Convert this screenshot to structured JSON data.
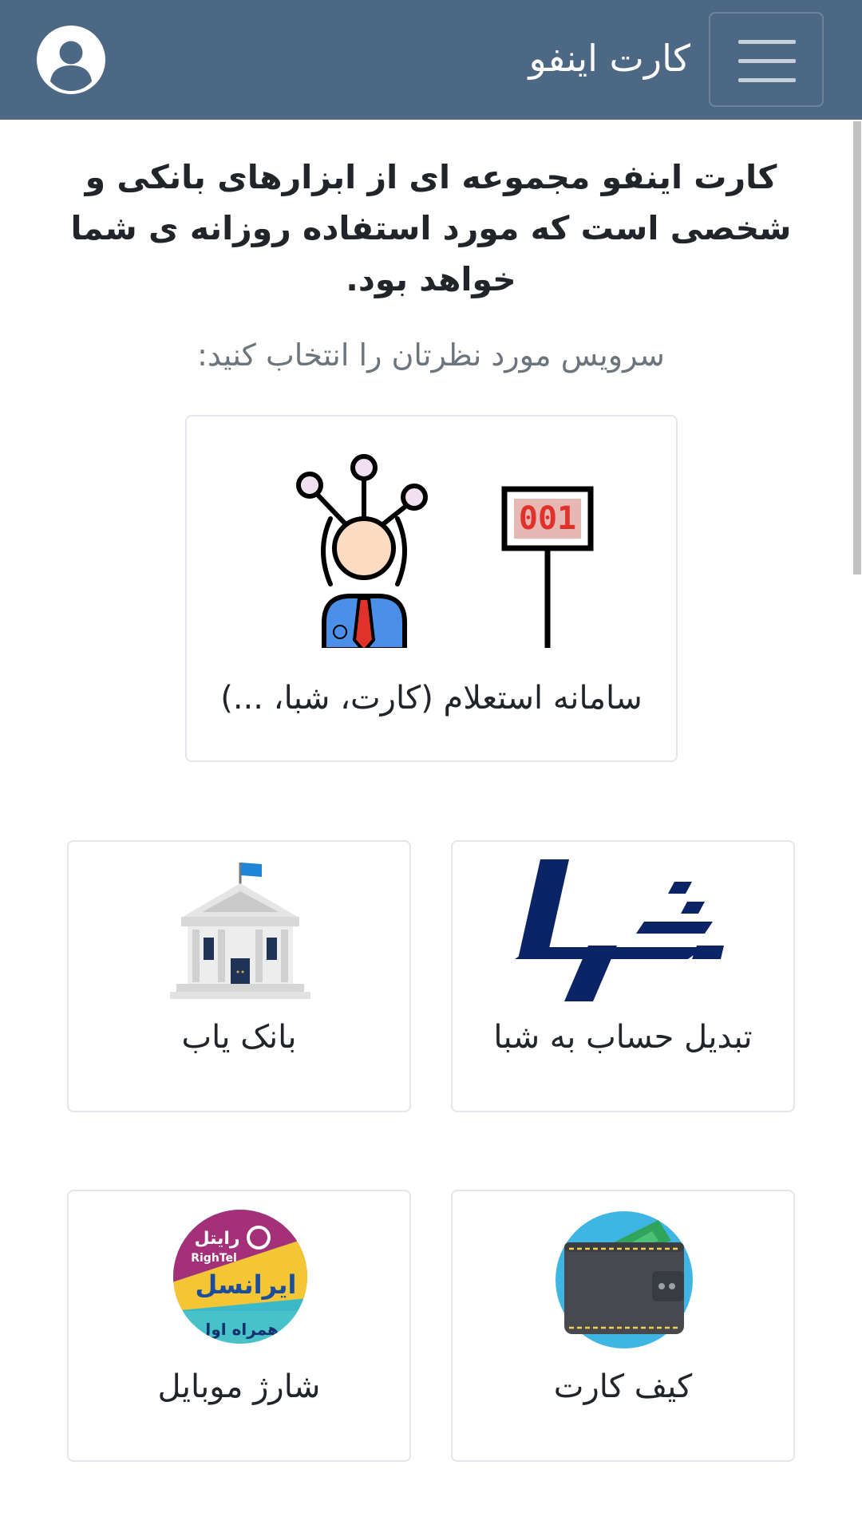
{
  "navbar": {
    "brand": "کارت اینفو",
    "menu_icon": "hamburger-menu-icon",
    "user_icon": "user-circle-icon",
    "background_color": "#4d6884"
  },
  "intro": {
    "heading": "کارت اینفو مجموعه ای از ابزارهای بانکی و شخصی است که مورد استفاده روزانه ی شما خواهد بود.",
    "prompt": "سرویس مورد نظرتان را انتخاب کنید:"
  },
  "services": {
    "inquiry": {
      "label": "سامانه استعلام (کارت، شبا، ...)",
      "icon": "inquiry-desk-icon",
      "display_number": "001"
    },
    "sheba": {
      "label": "تبدیل حساب به شبا",
      "icon": "sheba-logo-icon"
    },
    "bankyab": {
      "label": "بانک یاب",
      "icon": "bank-building-icon"
    },
    "wallet": {
      "label": "کیف کارت",
      "icon": "card-wallet-icon"
    },
    "charge": {
      "label": "شارژ موبایل",
      "icon": "mobile-operators-icon",
      "logo_texts": [
        "رایتل",
        "RighTel",
        "ایرانسل",
        "همراه اول"
      ]
    }
  },
  "colors": {
    "sheba_navy": "#0b2466",
    "prompt_gray": "#6c757d",
    "card_border": "#e3e6ea"
  }
}
